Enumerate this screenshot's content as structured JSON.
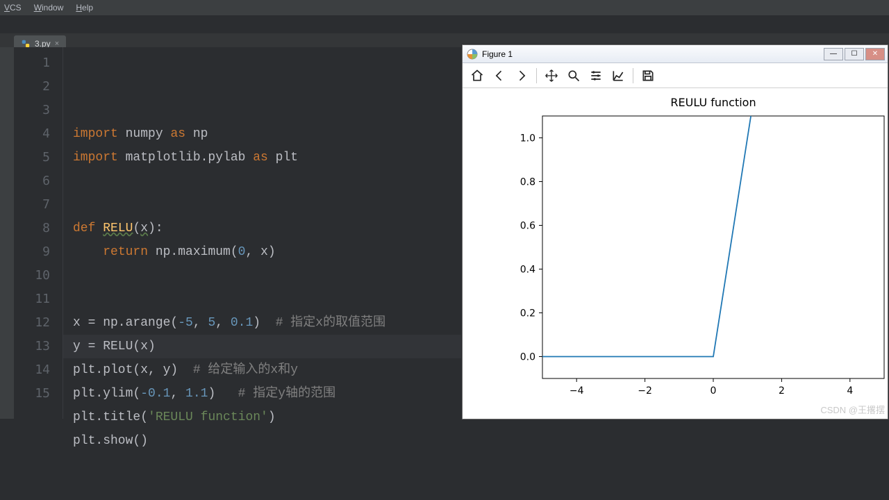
{
  "menu": {
    "vcs": "VCS",
    "window": "Window",
    "help": "Help"
  },
  "tab": {
    "filename": "3.py",
    "close_glyph": "×"
  },
  "gutter": {
    "lines": [
      "1",
      "2",
      "3",
      "4",
      "5",
      "6",
      "7",
      "8",
      "9",
      "10",
      "11",
      "12",
      "13",
      "14",
      "15"
    ]
  },
  "code": {
    "l1": {
      "kw_import": "import",
      "mod": "numpy",
      "kw_as": "as",
      "alias": "np"
    },
    "l2": {
      "kw_import": "import",
      "mod": "matplotlib.pylab",
      "kw_as": "as",
      "alias": "plt"
    },
    "l5": {
      "kw_def": "def",
      "fn": "RELU",
      "sig_open": "(",
      "arg": "x",
      "sig_close": "):"
    },
    "l6": {
      "kw_return": "return",
      "call": "np.maximum(",
      "zero": "0",
      "comma": ", ",
      "arg": "x",
      "close": ")"
    },
    "l9": {
      "lhs": "x = np.arange(",
      "a": "-5",
      "c1": ", ",
      "b": "5",
      "c2": ", ",
      "c": "0.1",
      "close": ")",
      "pad": "  ",
      "cmt": "# 指定x的取值范围"
    },
    "l10": {
      "txt": "y = RELU(x)"
    },
    "l11": {
      "txt": "plt.plot(x, y)",
      "pad": "  ",
      "cmt": "# 给定输入的x和y"
    },
    "l12": {
      "pre": "plt.ylim(",
      "a": "-0.1",
      "c1": ", ",
      "b": "1.1",
      "close": ")",
      "pad": "   ",
      "cmt": "# 指定y轴的范围"
    },
    "l13": {
      "pre": "plt.title(",
      "str": "'REULU function'",
      "close": ")"
    },
    "l14": {
      "txt": "plt.show()"
    }
  },
  "figure": {
    "window_title": "Figure 1",
    "toolbar_icons": [
      "home-icon",
      "back-icon",
      "forward-icon",
      "pan-icon",
      "zoom-icon",
      "configure-icon",
      "axes-icon",
      "save-icon"
    ]
  },
  "chart_data": {
    "type": "line",
    "title": "REULU function",
    "xlabel": "",
    "ylabel": "",
    "xlim": [
      -5,
      5
    ],
    "ylim": [
      -0.1,
      1.1
    ],
    "xticks": [
      -4,
      -2,
      0,
      2,
      4
    ],
    "yticks": [
      0.0,
      0.2,
      0.4,
      0.6,
      0.8,
      1.0
    ],
    "series": [
      {
        "name": "RELU",
        "x": [
          -5.0,
          -4.0,
          -3.0,
          -2.0,
          -1.0,
          0.0,
          0.1,
          0.2,
          0.3,
          0.4,
          0.5,
          0.6,
          0.7,
          0.8,
          0.9,
          1.0,
          1.1,
          2.0,
          3.0,
          4.0,
          4.9
        ],
        "y": [
          0.0,
          0.0,
          0.0,
          0.0,
          0.0,
          0.0,
          0.1,
          0.2,
          0.3,
          0.4,
          0.5,
          0.6,
          0.7,
          0.8,
          0.9,
          1.0,
          1.1,
          2.0,
          3.0,
          4.0,
          4.9
        ]
      }
    ]
  },
  "watermark": "CSDN @王撂摆"
}
